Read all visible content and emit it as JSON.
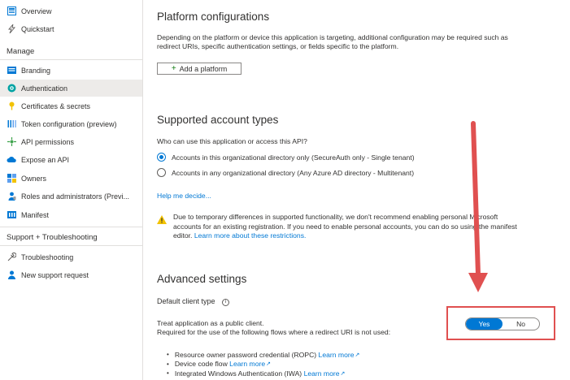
{
  "sidebar": {
    "items_top": [
      {
        "label": "Overview",
        "icon": "overview-icon"
      },
      {
        "label": "Quickstart",
        "icon": "quickstart-icon"
      }
    ],
    "manage_heading": "Manage",
    "manage_items": [
      {
        "label": "Branding",
        "icon": "branding-icon"
      },
      {
        "label": "Authentication",
        "icon": "authentication-icon",
        "active": true
      },
      {
        "label": "Certificates & secrets",
        "icon": "key-icon"
      },
      {
        "label": "Token configuration (preview)",
        "icon": "token-icon"
      },
      {
        "label": "API permissions",
        "icon": "api-permissions-icon"
      },
      {
        "label": "Expose an API",
        "icon": "cloud-icon"
      },
      {
        "label": "Owners",
        "icon": "owners-icon"
      },
      {
        "label": "Roles and administrators (Previ...",
        "icon": "roles-icon"
      },
      {
        "label": "Manifest",
        "icon": "manifest-icon"
      }
    ],
    "support_heading": "Support + Troubleshooting",
    "support_items": [
      {
        "label": "Troubleshooting",
        "icon": "wrench-icon"
      },
      {
        "label": "New support request",
        "icon": "support-person-icon"
      }
    ]
  },
  "platform": {
    "title": "Platform configurations",
    "desc_line1": "Depending on the platform or device this application is targeting, additional configuration may be required such as",
    "desc_line2": "redirect URIs, specific authentication settings, or fields specific to the platform.",
    "add_button": "Add a platform",
    "add_symbol": "+"
  },
  "accounts": {
    "title": "Supported account types",
    "question": "Who can use this application or access this API?",
    "option_single": "Accounts in this organizational directory only (SecureAuth only - Single tenant)",
    "option_multi": "Accounts in any organizational directory (Any Azure AD directory - Multitenant)",
    "help_link": "Help me decide..."
  },
  "warning": {
    "line1": "Due to temporary differences in supported functionality, we don't recommend enabling personal Microsoft",
    "line2": "accounts for an existing registration. If you need to enable personal accounts, you can do so using the manifest",
    "line3_prefix": "editor.",
    "line3_link": "Learn more about these restrictions."
  },
  "advanced": {
    "title": "Advanced settings",
    "default_client_type": "Default client type",
    "info_symbol": "i",
    "treat_public": "Treat application as a public client.",
    "required_flows": "Required for the use of the following flows where a redirect URI is not used:",
    "toggle_yes": "Yes",
    "toggle_no": "No",
    "toggle_value": "Yes",
    "flows": [
      {
        "text": "Resource owner password credential (ROPC)",
        "link": "Learn more"
      },
      {
        "text": "Device code flow",
        "link": "Learn more"
      },
      {
        "text": "Integrated Windows Authentication (IWA)",
        "link": "Learn more"
      }
    ]
  },
  "colors": {
    "accent": "#0078d4",
    "annotation_red": "#e05050",
    "warning_yellow": "#f2c200"
  }
}
